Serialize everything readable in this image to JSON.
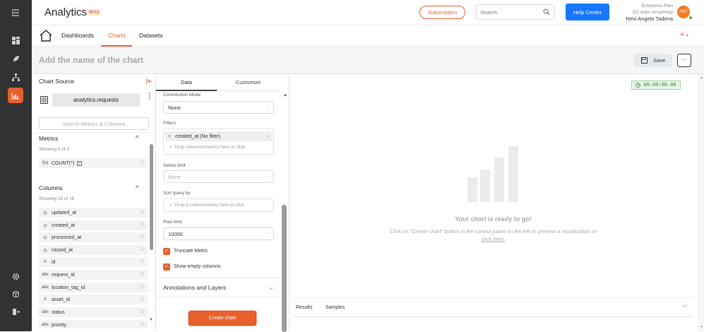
{
  "app": {
    "title": "Analytics",
    "beta_badge": "Beta"
  },
  "topbar": {
    "subscription_label": "Subscription",
    "search_placeholder": "Search",
    "help_label": "Help Center",
    "plan_line1": "Enterprise Plan",
    "plan_line2": "(52 days remaining)",
    "user_name": "Hevi Angelo Tadena",
    "avatar_initials": "HAT"
  },
  "nav": {
    "tabs": [
      {
        "label": "Dashboards"
      },
      {
        "label": "Charts"
      },
      {
        "label": "Datasets"
      }
    ]
  },
  "chart_header": {
    "title_placeholder": "Add the name of the chart",
    "save_label": "Save",
    "more_label": "···"
  },
  "source": {
    "title": "Chart Source",
    "dataset": "analytics.requests",
    "search_placeholder": "Search Metrics & Columns",
    "metrics_title": "Metrics",
    "metrics_count": "Showing 1 of 1",
    "metrics": [
      {
        "icon": "f(x)",
        "label": "COUNT(*)"
      }
    ],
    "columns_title": "Columns",
    "columns_count": "Showing 18 of 18",
    "columns": [
      {
        "icon": "clock",
        "label": "updated_at"
      },
      {
        "icon": "clock",
        "label": "created_at"
      },
      {
        "icon": "clock",
        "label": "processed_at"
      },
      {
        "icon": "clock",
        "label": "closed_at"
      },
      {
        "icon": "#",
        "label": "id"
      },
      {
        "icon": "abc",
        "label": "request_id"
      },
      {
        "icon": "abc",
        "label": "location_tag_id"
      },
      {
        "icon": "#",
        "label": "asset_id"
      },
      {
        "icon": "abc",
        "label": "status"
      },
      {
        "icon": "abc",
        "label": "priority"
      }
    ]
  },
  "controls": {
    "tab_data": "Data",
    "tab_customize": "Customize",
    "contribution_label": "Contribution Mode",
    "contribution_value": "None",
    "filters_label": "Filters",
    "filter_item": "created_at (No filter)",
    "filter_drop": "Drop columns/metrics here or click",
    "series_label": "Series limit",
    "series_value": "None",
    "sort_label": "Sort query by",
    "sort_drop": "Drop a column/metric here or click",
    "row_limit_label": "Row limit",
    "row_limit_value": "10000",
    "truncate_label": "Truncate Metric",
    "empty_cols_label": "Show empty columns",
    "annotations_label": "Annotations and Layers",
    "create_chart_label": "Create chart"
  },
  "preview": {
    "timer": "00:00:00.00",
    "ready_title": "Your chart is ready to go!",
    "ready_text": "Click on \"Create chart\" button in the control panel on the left to preview a visualization or",
    "click_here": "click here.",
    "tab_results": "Results",
    "tab_samples": "Samples"
  },
  "colors": {
    "accent": "#e8602e",
    "help_button": "#1677ff",
    "sidebar": "#323232"
  }
}
